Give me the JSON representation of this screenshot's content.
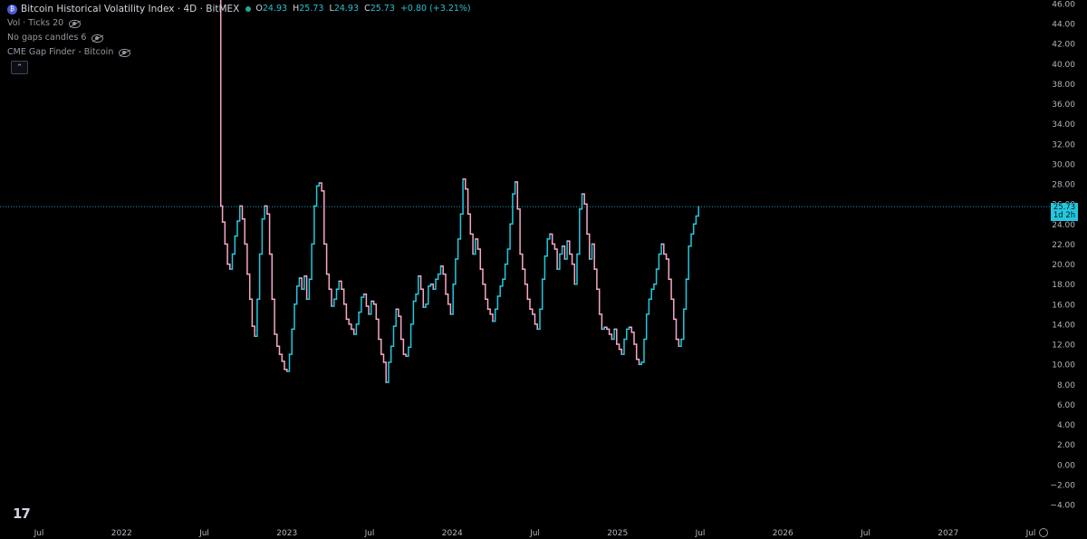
{
  "legend": {
    "title": "Bitcoin Historical Volatility Index · 4D · BitMEX",
    "ohlc": {
      "o_label": "O",
      "o": "24.93",
      "h_label": "H",
      "h": "25.73",
      "l_label": "L",
      "l": "24.93",
      "c_label": "C",
      "c": "25.73",
      "change": "+0.80 (+3.21%)"
    },
    "indicators": [
      "Vol · Ticks 20",
      "No gaps candles 6",
      "CME Gap Finder - Bitcoin"
    ],
    "collapse_glyph": "⌃"
  },
  "logo_text": "17",
  "price_label": {
    "value": "25.73",
    "countdown": "1d 2h"
  },
  "colors": {
    "background": "#000000",
    "up": "#22c7dd",
    "down": "#f7a7c4",
    "price_line": "#22c7dd",
    "axis_text": "#b2b5be"
  },
  "chart_data": {
    "type": "line",
    "title": "Bitcoin Historical Volatility Index · 4D · BitMEX",
    "y_axis": {
      "ticks": [
        "46.00",
        "44.00",
        "42.00",
        "40.00",
        "38.00",
        "36.00",
        "34.00",
        "32.00",
        "30.00",
        "28.00",
        "26.00",
        "24.00",
        "22.00",
        "20.00",
        "18.00",
        "16.00",
        "14.00",
        "12.00",
        "10.00",
        "8.00",
        "6.00",
        "4.00",
        "2.00",
        "0.00",
        "−2.00",
        "−4.00"
      ],
      "range": [
        -5,
        46.5
      ]
    },
    "x_axis": {
      "ticks": [
        {
          "label": "Jul",
          "t": 2021.5
        },
        {
          "label": "2022",
          "t": 2022.0
        },
        {
          "label": "Jul",
          "t": 2022.5
        },
        {
          "label": "2023",
          "t": 2023.0
        },
        {
          "label": "Jul",
          "t": 2023.5
        },
        {
          "label": "2024",
          "t": 2024.0
        },
        {
          "label": "Jul",
          "t": 2024.5
        },
        {
          "label": "2025",
          "t": 2025.0
        },
        {
          "label": "Jul",
          "t": 2025.5
        },
        {
          "label": "2026",
          "t": 2026.0
        },
        {
          "label": "Jul",
          "t": 2026.5
        },
        {
          "label": "2027",
          "t": 2027.0
        },
        {
          "label": "Jul",
          "t": 2027.5
        }
      ],
      "range": [
        2021.28,
        2027.83
      ]
    },
    "current_value": 25.73,
    "series": [
      {
        "values": [
          [
            2022.595,
            47.0
          ],
          [
            2022.6,
            25.8
          ],
          [
            2022.61,
            24.2
          ],
          [
            2022.625,
            22.0
          ],
          [
            2022.64,
            20.0
          ],
          [
            2022.655,
            19.5
          ],
          [
            2022.67,
            21.0
          ],
          [
            2022.685,
            22.8
          ],
          [
            2022.7,
            24.3
          ],
          [
            2022.715,
            25.8
          ],
          [
            2022.73,
            24.5
          ],
          [
            2022.745,
            22.0
          ],
          [
            2022.76,
            19.0
          ],
          [
            2022.775,
            16.5
          ],
          [
            2022.79,
            13.8
          ],
          [
            2022.805,
            12.8
          ],
          [
            2022.82,
            16.5
          ],
          [
            2022.835,
            21.0
          ],
          [
            2022.85,
            24.5
          ],
          [
            2022.865,
            25.8
          ],
          [
            2022.88,
            25.0
          ],
          [
            2022.895,
            21.0
          ],
          [
            2022.91,
            16.5
          ],
          [
            2022.925,
            13.0
          ],
          [
            2022.94,
            11.8
          ],
          [
            2022.955,
            11.0
          ],
          [
            2022.97,
            10.3
          ],
          [
            2022.985,
            9.5
          ],
          [
            2023.0,
            9.3
          ],
          [
            2023.015,
            11.0
          ],
          [
            2023.03,
            13.5
          ],
          [
            2023.045,
            16.0
          ],
          [
            2023.06,
            17.8
          ],
          [
            2023.075,
            18.6
          ],
          [
            2023.09,
            17.5
          ],
          [
            2023.105,
            18.8
          ],
          [
            2023.12,
            16.5
          ],
          [
            2023.135,
            18.5
          ],
          [
            2023.15,
            22.0
          ],
          [
            2023.165,
            25.8
          ],
          [
            2023.18,
            27.8
          ],
          [
            2023.195,
            28.1
          ],
          [
            2023.21,
            27.3
          ],
          [
            2023.225,
            22.0
          ],
          [
            2023.24,
            19.0
          ],
          [
            2023.255,
            17.5
          ],
          [
            2023.27,
            15.8
          ],
          [
            2023.285,
            16.5
          ],
          [
            2023.3,
            17.5
          ],
          [
            2023.315,
            18.3
          ],
          [
            2023.33,
            17.5
          ],
          [
            2023.345,
            16.0
          ],
          [
            2023.36,
            14.5
          ],
          [
            2023.375,
            14.0
          ],
          [
            2023.39,
            13.5
          ],
          [
            2023.405,
            13.0
          ],
          [
            2023.42,
            14.0
          ],
          [
            2023.435,
            15.2
          ],
          [
            2023.45,
            16.7
          ],
          [
            2023.465,
            17.0
          ],
          [
            2023.48,
            15.8
          ],
          [
            2023.495,
            15.0
          ],
          [
            2023.51,
            16.3
          ],
          [
            2023.525,
            16.0
          ],
          [
            2023.54,
            14.5
          ],
          [
            2023.555,
            12.5
          ],
          [
            2023.57,
            11.0
          ],
          [
            2023.585,
            10.2
          ],
          [
            2023.6,
            8.2
          ],
          [
            2023.615,
            10.2
          ],
          [
            2023.63,
            11.8
          ],
          [
            2023.645,
            13.8
          ],
          [
            2023.66,
            15.5
          ],
          [
            2023.675,
            14.8
          ],
          [
            2023.69,
            12.5
          ],
          [
            2023.705,
            11.0
          ],
          [
            2023.72,
            10.8
          ],
          [
            2023.735,
            11.7
          ],
          [
            2023.75,
            14.0
          ],
          [
            2023.765,
            16.3
          ],
          [
            2023.78,
            17.0
          ],
          [
            2023.795,
            18.8
          ],
          [
            2023.81,
            17.5
          ],
          [
            2023.825,
            15.7
          ],
          [
            2023.84,
            16.0
          ],
          [
            2023.855,
            17.8
          ],
          [
            2023.87,
            18.0
          ],
          [
            2023.885,
            17.5
          ],
          [
            2023.9,
            18.5
          ],
          [
            2023.915,
            19.0
          ],
          [
            2023.93,
            19.8
          ],
          [
            2023.945,
            19.0
          ],
          [
            2023.96,
            17.0
          ],
          [
            2023.975,
            16.0
          ],
          [
            2023.99,
            15.0
          ],
          [
            2024.005,
            18.0
          ],
          [
            2024.02,
            20.5
          ],
          [
            2024.035,
            22.5
          ],
          [
            2024.05,
            25.0
          ],
          [
            2024.065,
            28.5
          ],
          [
            2024.08,
            27.5
          ],
          [
            2024.095,
            25.0
          ],
          [
            2024.11,
            23.0
          ],
          [
            2024.125,
            21.0
          ],
          [
            2024.14,
            22.5
          ],
          [
            2024.155,
            21.5
          ],
          [
            2024.17,
            19.5
          ],
          [
            2024.185,
            18.0
          ],
          [
            2024.2,
            16.5
          ],
          [
            2024.215,
            15.5
          ],
          [
            2024.23,
            15.0
          ],
          [
            2024.245,
            14.3
          ],
          [
            2024.26,
            15.5
          ],
          [
            2024.275,
            16.8
          ],
          [
            2024.29,
            17.8
          ],
          [
            2024.305,
            18.5
          ],
          [
            2024.32,
            20.0
          ],
          [
            2024.335,
            21.5
          ],
          [
            2024.35,
            24.0
          ],
          [
            2024.365,
            27.0
          ],
          [
            2024.38,
            28.2
          ],
          [
            2024.395,
            25.5
          ],
          [
            2024.41,
            21.0
          ],
          [
            2024.425,
            19.5
          ],
          [
            2024.44,
            18.0
          ],
          [
            2024.455,
            16.5
          ],
          [
            2024.47,
            15.5
          ],
          [
            2024.485,
            15.0
          ],
          [
            2024.5,
            14.0
          ],
          [
            2024.515,
            13.5
          ],
          [
            2024.53,
            15.5
          ],
          [
            2024.545,
            18.5
          ],
          [
            2024.56,
            20.8
          ],
          [
            2024.575,
            22.5
          ],
          [
            2024.59,
            23.0
          ],
          [
            2024.605,
            22.0
          ],
          [
            2024.62,
            21.5
          ],
          [
            2024.635,
            19.5
          ],
          [
            2024.65,
            21.0
          ],
          [
            2024.665,
            21.8
          ],
          [
            2024.68,
            20.5
          ],
          [
            2024.695,
            22.3
          ],
          [
            2024.71,
            21.0
          ],
          [
            2024.725,
            20.0
          ],
          [
            2024.74,
            18.0
          ],
          [
            2024.755,
            21.0
          ],
          [
            2024.77,
            25.5
          ],
          [
            2024.785,
            27.0
          ],
          [
            2024.8,
            26.0
          ],
          [
            2024.815,
            23.0
          ],
          [
            2024.83,
            20.5
          ],
          [
            2024.845,
            22.0
          ],
          [
            2024.86,
            19.5
          ],
          [
            2024.875,
            17.5
          ],
          [
            2024.89,
            15.0
          ],
          [
            2024.905,
            13.5
          ],
          [
            2024.92,
            13.7
          ],
          [
            2024.935,
            13.5
          ],
          [
            2024.95,
            13.0
          ],
          [
            2024.965,
            12.5
          ],
          [
            2024.98,
            13.5
          ],
          [
            2024.995,
            12.0
          ],
          [
            2025.01,
            11.5
          ],
          [
            2025.025,
            11.0
          ],
          [
            2025.04,
            12.5
          ],
          [
            2025.055,
            13.5
          ],
          [
            2025.07,
            13.7
          ],
          [
            2025.085,
            13.2
          ],
          [
            2025.1,
            12.0
          ],
          [
            2025.115,
            10.5
          ],
          [
            2025.13,
            10.0
          ],
          [
            2025.145,
            10.2
          ],
          [
            2025.16,
            12.5
          ],
          [
            2025.175,
            15.0
          ],
          [
            2025.19,
            16.5
          ],
          [
            2025.205,
            17.5
          ],
          [
            2025.22,
            18.0
          ],
          [
            2025.235,
            19.5
          ],
          [
            2025.25,
            21.0
          ],
          [
            2025.265,
            22.0
          ],
          [
            2025.28,
            21.0
          ],
          [
            2025.295,
            20.5
          ],
          [
            2025.31,
            18.5
          ],
          [
            2025.325,
            16.5
          ],
          [
            2025.34,
            14.5
          ],
          [
            2025.355,
            12.5
          ],
          [
            2025.37,
            11.8
          ],
          [
            2025.385,
            12.5
          ],
          [
            2025.4,
            15.5
          ],
          [
            2025.415,
            18.5
          ],
          [
            2025.43,
            21.8
          ],
          [
            2025.445,
            23.0
          ],
          [
            2025.46,
            24.0
          ],
          [
            2025.475,
            24.8
          ],
          [
            2025.49,
            25.73
          ]
        ]
      }
    ]
  }
}
